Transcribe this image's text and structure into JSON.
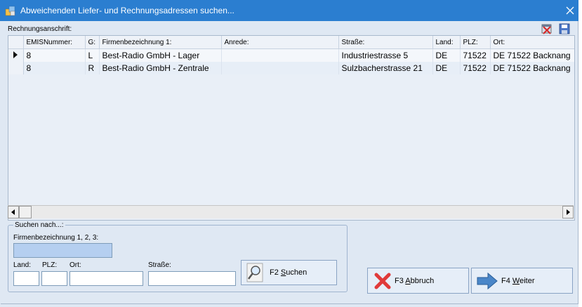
{
  "window": {
    "title": "Abweichenden Liefer- und Rechnungsadressen suchen..."
  },
  "section_label": "Rechnungsanschrift:",
  "grid": {
    "columns": [
      "EMISNummer:",
      "G:",
      "Firmenbezeichnung 1:",
      "Anrede:",
      "Straße:",
      "Land:",
      "PLZ:",
      "Ort:"
    ],
    "rows": [
      {
        "emis": "8",
        "g": "L",
        "firma": "Best-Radio GmbH - Lager",
        "anrede": "",
        "strasse": "Industriestrasse 5",
        "land": "DE",
        "plz": "71522",
        "ort": "DE 71522 Backnang"
      },
      {
        "emis": "8",
        "g": "R",
        "firma": "Best-Radio GmbH - Zentrale",
        "anrede": "",
        "strasse": "Sulzbacherstrasse 21",
        "land": "DE",
        "plz": "71522",
        "ort": "DE 71522 Backnang"
      }
    ]
  },
  "search": {
    "legend": "Suchen nach...:",
    "firma_label": "Firmenbezeichnung 1, 2, 3:",
    "firma_value": "",
    "land_label": "Land:",
    "land_value": "",
    "plz_label": "PLZ:",
    "plz_value": "",
    "ort_label": "Ort:",
    "ort_value": "",
    "strasse_label": "Straße:",
    "strasse_value": "",
    "search_button": {
      "prefix": "F2 ",
      "mnemonic": "S",
      "rest": "uchen"
    }
  },
  "buttons": {
    "cancel": {
      "prefix": "F3 ",
      "mnemonic": "A",
      "rest": "bbruch"
    },
    "next": {
      "prefix": "F4 ",
      "mnemonic": "W",
      "rest": "eiter"
    }
  },
  "colors": {
    "titlebar": "#2b7ed0",
    "background": "#dfe8f3",
    "active_input": "#b5cff0",
    "cancel_x": "#e03a3a",
    "arrow": "#4a86c8"
  }
}
